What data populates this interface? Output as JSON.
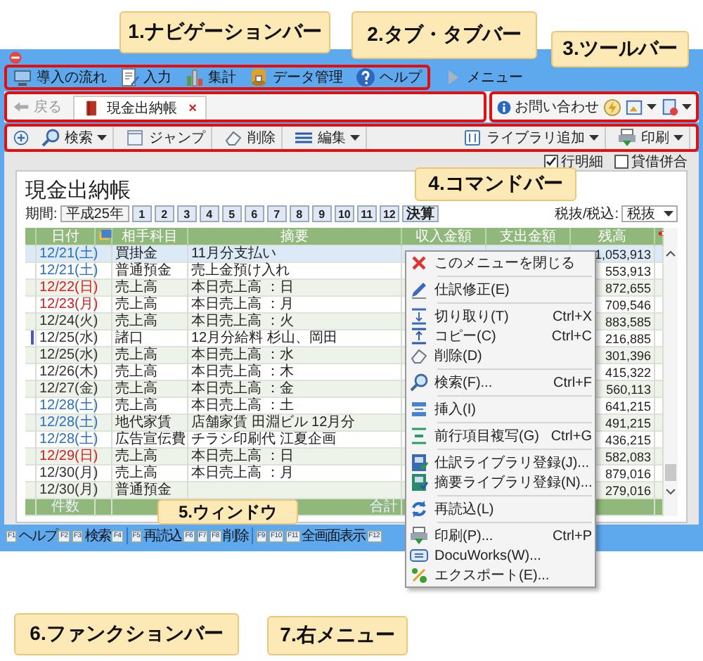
{
  "callouts": [
    {
      "text": "1.ナビゲーションバー"
    },
    {
      "text": "2.タブ・タブバー"
    },
    {
      "text": "3.ツールバー"
    },
    {
      "text": "4.コマンドバー"
    },
    {
      "text": "5.ウィンドウ"
    },
    {
      "text": "6.ファンクションバー"
    },
    {
      "text": "7.右メニュー"
    }
  ],
  "navigation_bar": {
    "items": [
      "導入の流れ",
      "入力",
      "集計",
      "データ管理",
      "ヘルプ",
      "メニュー"
    ]
  },
  "tab_bar": {
    "back": "戻る",
    "tabs": [
      {
        "label": "現金出納帳",
        "close": "×",
        "selected": true
      }
    ]
  },
  "toolbar": {
    "contact": "お問い合わせ"
  },
  "command_bar": {
    "left": [
      {
        "label": "検索",
        "dropdown": true
      },
      {
        "label": "ジャンプ",
        "dropdown": false
      },
      {
        "label": "削除",
        "dropdown": false
      },
      {
        "label": "編集",
        "dropdown": true
      }
    ],
    "right": [
      {
        "label": "ライブラリ追加",
        "dropdown": true
      },
      {
        "label": "印刷",
        "dropdown": true
      }
    ]
  },
  "options": [
    {
      "label": "行明細",
      "checked": true
    },
    {
      "label": "貸借併合",
      "checked": false
    }
  ],
  "ledger": {
    "title": "現金出納帳",
    "period_label": "期間:",
    "year": "平成25年",
    "periods": [
      {
        "label": "1",
        "selected": false
      },
      {
        "label": "2",
        "selected": false
      },
      {
        "label": "3",
        "selected": false
      },
      {
        "label": "4",
        "selected": false
      },
      {
        "label": "5",
        "selected": false
      },
      {
        "label": "6",
        "selected": false
      },
      {
        "label": "7",
        "selected": false
      },
      {
        "label": "8",
        "selected": false
      },
      {
        "label": "9",
        "selected": false
      },
      {
        "label": "10",
        "selected": false
      },
      {
        "label": "11",
        "selected": false
      },
      {
        "label": "12",
        "selected": false
      },
      {
        "label": "決算",
        "selected": false
      }
    ],
    "tax_label": "税抜/税込:",
    "tax_mode": "税抜",
    "columns": [
      "日付",
      "相手科目",
      "摘要",
      "収入金額",
      "支出金額",
      "残高"
    ],
    "rows": [
      {
        "date": "12/21(土)",
        "color": "#2a6fc0",
        "account": "買掛金",
        "memo": "11月分支払い",
        "balance": "1,053,913",
        "selected": true,
        "flagged": false
      },
      {
        "date": "12/21(土)",
        "color": "#2a6fc0",
        "account": "普通預金",
        "memo": "売上金預け入れ",
        "balance": "553,913",
        "selected": false,
        "flagged": false
      },
      {
        "date": "12/22(日)",
        "color": "#d02020",
        "account": "売上高",
        "memo": "本日売上高 ：日",
        "balance": "872,655",
        "selected": false,
        "flagged": false
      },
      {
        "date": "12/23(月)",
        "color": "#d02020",
        "account": "売上高",
        "memo": "本日売上高 ：月",
        "balance": "709,546",
        "selected": false,
        "flagged": false
      },
      {
        "date": "12/24(火)",
        "color": "#333333",
        "account": "売上高",
        "memo": "本日売上高 ：火",
        "balance": "883,585",
        "selected": false,
        "flagged": false
      },
      {
        "date": "12/25(水)",
        "color": "#333333",
        "account": "諸口",
        "memo": "12月分給料 杉山、岡田",
        "balance": "216,885",
        "selected": false,
        "flagged": true
      },
      {
        "date": "12/25(水)",
        "color": "#333333",
        "account": "売上高",
        "memo": "本日売上高 ：水",
        "balance": "301,396",
        "selected": false,
        "flagged": false
      },
      {
        "date": "12/26(木)",
        "color": "#333333",
        "account": "売上高",
        "memo": "本日売上高 ：木",
        "balance": "415,322",
        "selected": false,
        "flagged": false
      },
      {
        "date": "12/27(金)",
        "color": "#333333",
        "account": "売上高",
        "memo": "本日売上高 ：金",
        "balance": "560,113",
        "selected": false,
        "flagged": false
      },
      {
        "date": "12/28(土)",
        "color": "#2a6fc0",
        "account": "売上高",
        "memo": "本日売上高 ：土",
        "balance": "641,215",
        "selected": false,
        "flagged": false
      },
      {
        "date": "12/28(土)",
        "color": "#2a6fc0",
        "account": "地代家賃",
        "memo": "店舗家賃 田淵ビル 12月分",
        "balance": "491,215",
        "selected": false,
        "flagged": false
      },
      {
        "date": "12/28(土)",
        "color": "#2a6fc0",
        "account": "広告宣伝費",
        "memo": "チラシ印刷代 江夏企画",
        "balance": "436,215",
        "selected": false,
        "flagged": false
      },
      {
        "date": "12/29(日)",
        "color": "#d02020",
        "account": "売上高",
        "memo": "本日売上高 ：日",
        "balance": "582,083",
        "selected": false,
        "flagged": false
      },
      {
        "date": "12/30(月)",
        "color": "#333333",
        "account": "売上高",
        "memo": "本日売上高 ：月",
        "balance": "879,016",
        "selected": false,
        "flagged": false
      },
      {
        "date": "12/30(月)",
        "color": "#333333",
        "account": "普通預金",
        "balance": "279,016",
        "selected": false,
        "flagged": false
      }
    ],
    "footer": {
      "count_label": "件数",
      "total_label": "合計"
    }
  },
  "context_menu": {
    "groups": [
      [
        {
          "label": "このメニューを閉じる"
        }
      ],
      [
        {
          "label": "仕訳修正(E)"
        }
      ],
      [
        {
          "label": "切り取り(T)",
          "shortcut": "Ctrl+X"
        },
        {
          "label": "コピー(C)",
          "shortcut": "Ctrl+C"
        },
        {
          "label": "削除(D)"
        }
      ],
      [
        {
          "label": "検索(F)...",
          "shortcut": "Ctrl+F"
        }
      ],
      [
        {
          "label": "挿入(I)"
        }
      ],
      [
        {
          "label": "前行項目複写(G)",
          "shortcut": "Ctrl+G"
        }
      ],
      [
        {
          "label": "仕訳ライブラリ登録(J)..."
        },
        {
          "label": "摘要ライブラリ登録(N)..."
        }
      ],
      [
        {
          "label": "再読込(L)"
        }
      ],
      [
        {
          "label": "印刷(P)...",
          "shortcut": "Ctrl+P"
        },
        {
          "label": "DocuWorks(W)..."
        },
        {
          "label": "エクスポート(E)..."
        }
      ]
    ]
  },
  "function_keys": [
    {
      "key": "F1",
      "label": "ヘルプ"
    },
    {
      "key": "F2"
    },
    {
      "key": "F3",
      "label": "検索"
    },
    {
      "key": "F4"
    },
    {
      "key": "F5",
      "label": "再読込"
    },
    {
      "key": "F6"
    },
    {
      "key": "F7"
    },
    {
      "key": "F8",
      "label": "削除"
    },
    {
      "key": "F9"
    },
    {
      "key": "F10"
    },
    {
      "key": "F11",
      "label": "全画面表示"
    },
    {
      "key": "F12"
    }
  ]
}
